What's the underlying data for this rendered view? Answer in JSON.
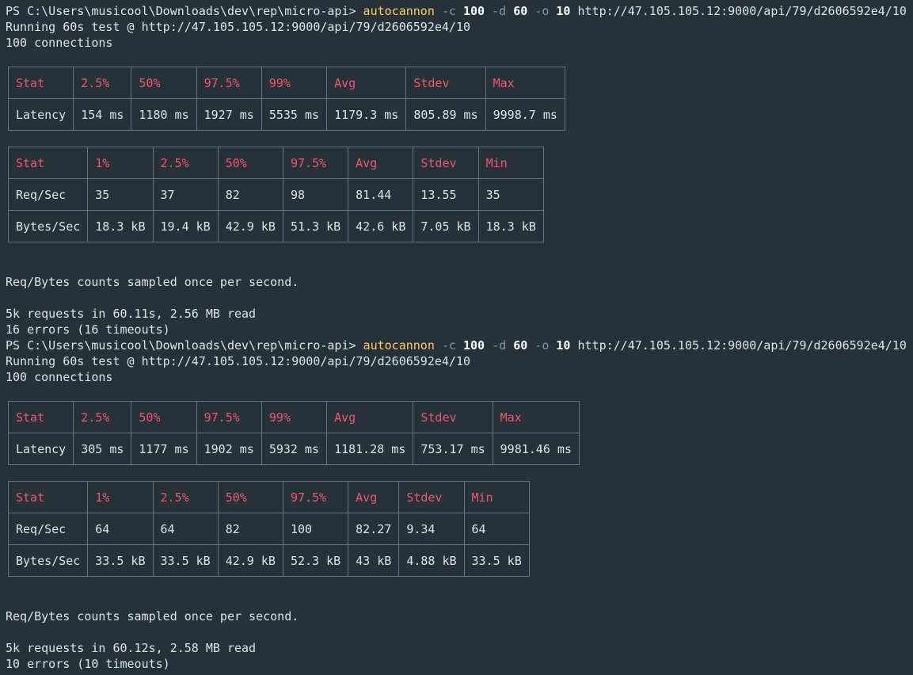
{
  "colors": {
    "background": "#263238",
    "text": "#dfe3e6",
    "command": "#ffcb6b",
    "header": "#f0566e",
    "border": "#66747d"
  },
  "runs": [
    {
      "prompt": "PS C:\\Users\\musicool\\Downloads\\dev\\rep\\micro-api>",
      "command": "autocannon",
      "flag_c": "-c",
      "val_c": "100",
      "flag_d": "-d",
      "val_d": "60",
      "flag_o": "-o",
      "val_o": "10",
      "url": "http://47.105.105.12:9000/api/79/d2606592e4/10",
      "running": "Running 60s test @ http://47.105.105.12:9000/api/79/d2606592e4/10",
      "connections": "100 connections",
      "latency_table": {
        "headers": [
          "Stat",
          "2.5%",
          "50%",
          "97.5%",
          "99%",
          "Avg",
          "Stdev",
          "Max"
        ],
        "rows": [
          [
            "Latency",
            "154 ms",
            "1180 ms",
            "1927 ms",
            "5535 ms",
            "1179.3 ms",
            "805.89 ms",
            "9998.7 ms"
          ]
        ]
      },
      "throughput_table": {
        "headers": [
          "Stat",
          "1%",
          "2.5%",
          "50%",
          "97.5%",
          "Avg",
          "Stdev",
          "Min"
        ],
        "rows": [
          [
            "Req/Sec",
            "35",
            "37",
            "82",
            "98",
            "81.44",
            "13.55",
            "35"
          ],
          [
            "Bytes/Sec",
            "18.3 kB",
            "19.4 kB",
            "42.9 kB",
            "51.3 kB",
            "42.6 kB",
            "7.05 kB",
            "18.3 kB"
          ]
        ]
      },
      "sampled_note": "Req/Bytes counts sampled once per second.",
      "summary": "5k requests in 60.11s, 2.56 MB read",
      "errors": "16 errors (16 timeouts)"
    },
    {
      "prompt": "PS C:\\Users\\musicool\\Downloads\\dev\\rep\\micro-api>",
      "command": "autocannon",
      "flag_c": "-c",
      "val_c": "100",
      "flag_d": "-d",
      "val_d": "60",
      "flag_o": "-o",
      "val_o": "10",
      "url": "http://47.105.105.12:9000/api/79/d2606592e4/10",
      "running": "Running 60s test @ http://47.105.105.12:9000/api/79/d2606592e4/10",
      "connections": "100 connections",
      "latency_table": {
        "headers": [
          "Stat",
          "2.5%",
          "50%",
          "97.5%",
          "99%",
          "Avg",
          "Stdev",
          "Max"
        ],
        "rows": [
          [
            "Latency",
            "305 ms",
            "1177 ms",
            "1902 ms",
            "5932 ms",
            "1181.28 ms",
            "753.17 ms",
            "9981.46 ms"
          ]
        ]
      },
      "throughput_table": {
        "headers": [
          "Stat",
          "1%",
          "2.5%",
          "50%",
          "97.5%",
          "Avg",
          "Stdev",
          "Min"
        ],
        "rows": [
          [
            "Req/Sec",
            "64",
            "64",
            "82",
            "100",
            "82.27",
            "9.34",
            "64"
          ],
          [
            "Bytes/Sec",
            "33.5 kB",
            "33.5 kB",
            "42.9 kB",
            "52.3 kB",
            "43 kB",
            "4.88 kB",
            "33.5 kB"
          ]
        ]
      },
      "sampled_note": "Req/Bytes counts sampled once per second.",
      "summary": "5k requests in 60.12s, 2.58 MB read",
      "errors": "10 errors (10 timeouts)"
    }
  ]
}
